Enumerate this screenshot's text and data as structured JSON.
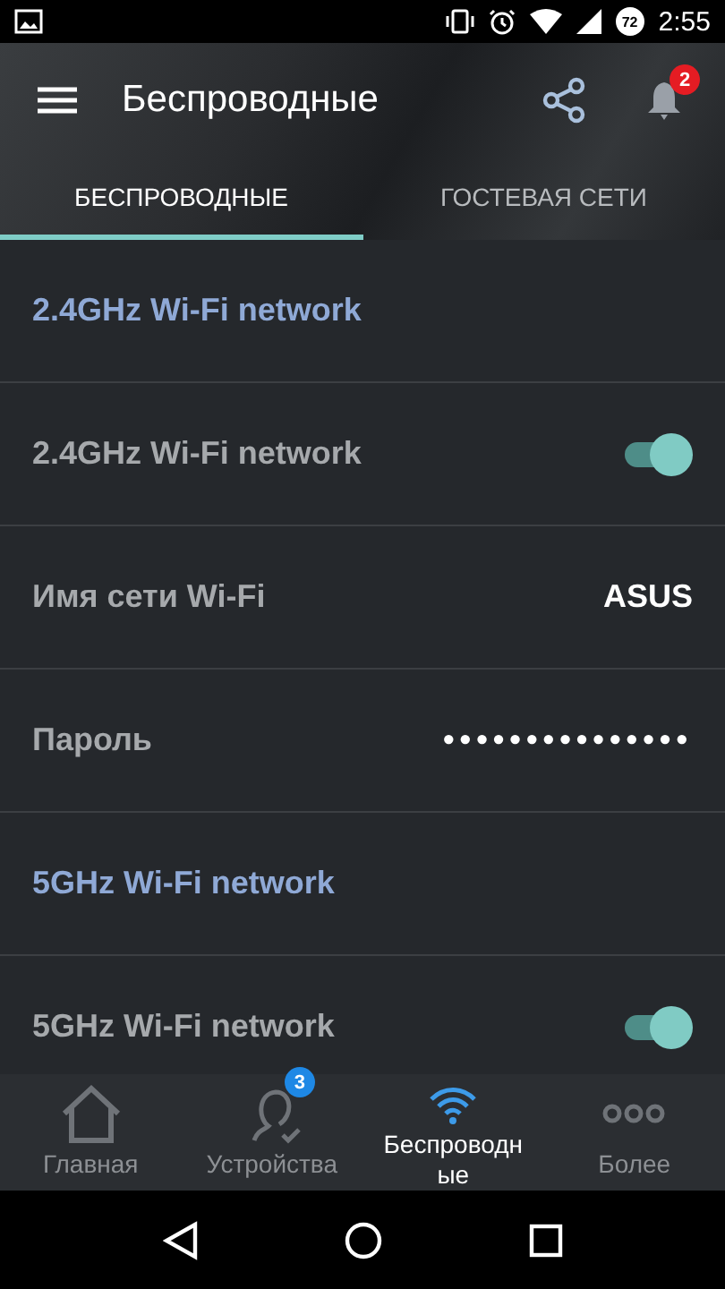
{
  "status_bar": {
    "battery": "72",
    "time": "2:55"
  },
  "header": {
    "title": "Беспроводные",
    "notifications": "2"
  },
  "tabs": [
    {
      "label": "БЕСПРОВОДНЫЕ",
      "selected": true
    },
    {
      "label": "ГОСТЕВАЯ СЕТИ",
      "selected": false
    }
  ],
  "rows": [
    {
      "kind": "section",
      "label": "2.4GHz Wi-Fi network"
    },
    {
      "kind": "toggle",
      "label": "2.4GHz Wi-Fi network",
      "on": true
    },
    {
      "kind": "value",
      "label": "Имя сети Wi-Fi",
      "value": "ASUS"
    },
    {
      "kind": "password",
      "label": "Пароль",
      "value": "•••••••••••••••"
    },
    {
      "kind": "section",
      "label": "5GHz Wi-Fi network"
    },
    {
      "kind": "toggle",
      "label": "5GHz Wi-Fi network",
      "on": true
    }
  ],
  "bottom_nav": [
    {
      "kind": "home",
      "label": "Главная",
      "selected": false
    },
    {
      "kind": "devices",
      "label": "Устройства",
      "badge": "3",
      "selected": false
    },
    {
      "kind": "wifi",
      "label": "Беспроводные",
      "selected": true
    },
    {
      "kind": "more",
      "label": "Более",
      "selected": false
    }
  ]
}
